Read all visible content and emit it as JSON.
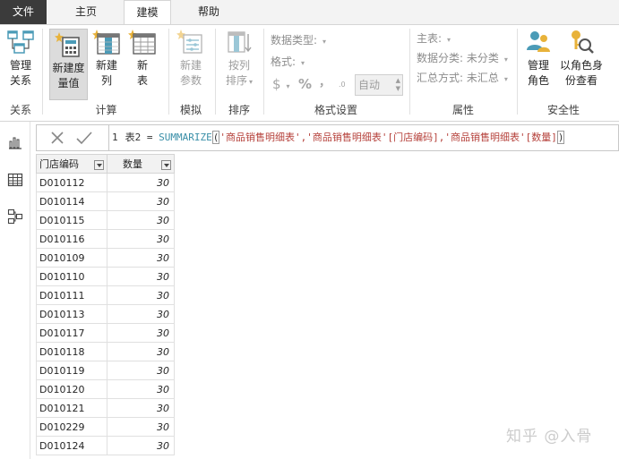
{
  "tabs": {
    "file": "文件",
    "home": "主页",
    "model": "建模",
    "help": "帮助",
    "active": "建模"
  },
  "ribbon": {
    "relationships": {
      "group_label": "关系",
      "manage_line1": "管理",
      "manage_line2": "关系"
    },
    "calculations": {
      "group_label": "计算",
      "new_measure_line1": "新建度",
      "new_measure_line2": "量值",
      "new_column_line1": "新建",
      "new_column_line2": "列",
      "new_table_line1": "新",
      "new_table_line2": "表"
    },
    "whatif": {
      "group_label": "模拟",
      "new_param_line1": "新建",
      "new_param_line2": "参数"
    },
    "sort": {
      "group_label": "排序",
      "sort_by_line1": "按列",
      "sort_by_line2": "排序"
    },
    "formatting": {
      "group_label": "格式设置",
      "data_type": "数据类型:",
      "format": "格式:",
      "currency_symbol": "$",
      "percent_symbol": "%",
      "comma_symbol": "，",
      "decimal_symbol": ".0",
      "decimals_value": "自动"
    },
    "properties": {
      "group_label": "属性",
      "home_table": "主表:",
      "data_category": "数据分类: 未分类",
      "summarize_by": "汇总方式: 未汇总"
    },
    "security": {
      "group_label": "安全性",
      "manage_roles_line1": "管理",
      "manage_roles_line2": "角色",
      "view_as_line1": "以角色身",
      "view_as_line2": "份查看"
    }
  },
  "formula": {
    "line_number": "1",
    "prefix": "表2 = ",
    "function": "SUMMARIZE",
    "open_paren": "(",
    "arg1": "'商品销售明细表'",
    "arg2": ",'商品销售明细表'[门店编码]",
    "arg3": ",'商品销售明细表'[数量]",
    "close_paren": ")"
  },
  "table": {
    "columns": [
      "门店编码",
      "数量"
    ],
    "rows": [
      [
        "D010112",
        "30"
      ],
      [
        "D010114",
        "30"
      ],
      [
        "D010115",
        "30"
      ],
      [
        "D010116",
        "30"
      ],
      [
        "D010109",
        "30"
      ],
      [
        "D010110",
        "30"
      ],
      [
        "D010111",
        "30"
      ],
      [
        "D010113",
        "30"
      ],
      [
        "D010117",
        "30"
      ],
      [
        "D010118",
        "30"
      ],
      [
        "D010119",
        "30"
      ],
      [
        "D010120",
        "30"
      ],
      [
        "D010121",
        "30"
      ],
      [
        "D010229",
        "30"
      ],
      [
        "D010124",
        "30"
      ]
    ]
  },
  "watermark": "知乎 @入骨",
  "icons": {
    "rail": [
      "report-view-icon",
      "data-view-icon",
      "model-view-icon"
    ],
    "formula": [
      "cancel-icon",
      "commit-check-icon"
    ]
  },
  "colors": {
    "file_tab_bg": "#3b3b3b",
    "function_color": "#3a8fa8",
    "string_color": "#b5403a",
    "icon_teal": "#4b9bb7",
    "icon_gold": "#e8b23a"
  }
}
